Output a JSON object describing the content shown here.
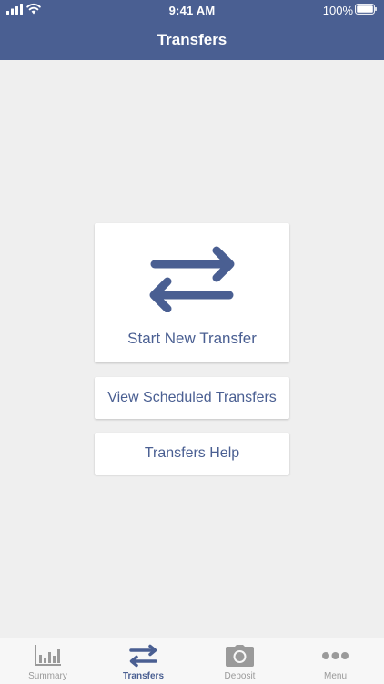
{
  "status": {
    "time": "9:41 AM",
    "battery": "100%"
  },
  "header": {
    "title": "Transfers"
  },
  "actions": {
    "start_new": "Start New Transfer",
    "view_scheduled": "View Scheduled Transfers",
    "help": "Transfers Help"
  },
  "tabbar": {
    "items": [
      {
        "label": "Summary",
        "icon": "bar-chart-icon",
        "active": false
      },
      {
        "label": "Transfers",
        "icon": "transfer-arrows-icon",
        "active": true
      },
      {
        "label": "Deposit",
        "icon": "camera-icon",
        "active": false
      },
      {
        "label": "Menu",
        "icon": "more-dots-icon",
        "active": false
      }
    ]
  },
  "colors": {
    "brand": "#4a5f92",
    "background": "#efefef",
    "inactive_tab": "#9a9a9a"
  }
}
